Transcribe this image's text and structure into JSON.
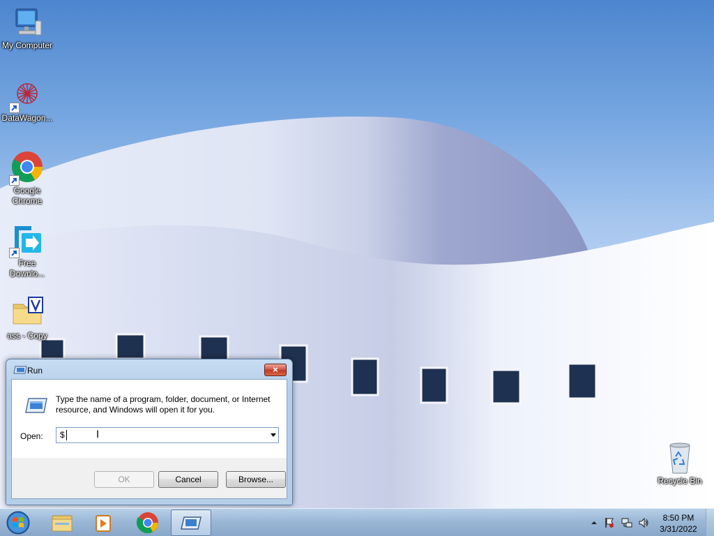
{
  "desktop": {
    "icons": [
      {
        "label": "My Computer"
      },
      {
        "label": "DataWagon..."
      },
      {
        "label": "Google Chrome"
      },
      {
        "label": "Free Downlo..."
      },
      {
        "label": "ass - Copy"
      },
      {
        "label": "Recycle Bin"
      }
    ]
  },
  "run_dialog": {
    "title": "Run",
    "close_glyph": "×",
    "description": "Type the name of a program, folder, document, or Internet resource, and Windows will open it for you.",
    "open_label": "Open:",
    "open_value": "$",
    "ok_label": "OK",
    "cancel_label": "Cancel",
    "browse_label": "Browse..."
  },
  "taskbar": {
    "items": [
      "start-orb",
      "windows-explorer",
      "media-player",
      "google-chrome",
      "run-dialog"
    ],
    "tray": {
      "time": "8:50 PM",
      "date": "3/31/2022"
    }
  },
  "colors": {
    "close_button": "#c23a24",
    "taskbar": "#9fb8d6",
    "sky": "#7aa9e2"
  }
}
